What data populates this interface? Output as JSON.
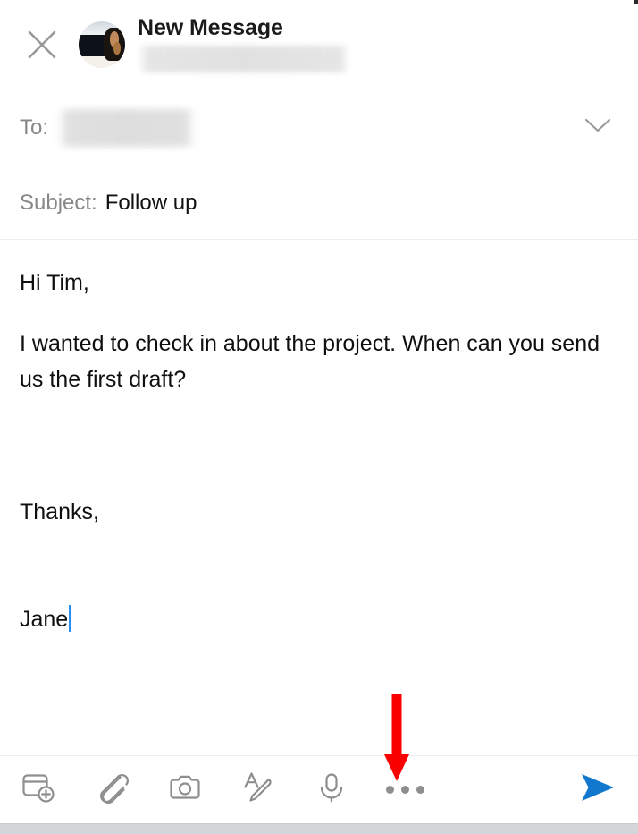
{
  "app": {
    "screen_title": "New Message"
  },
  "header": {
    "close_icon": "close-x-icon",
    "avatar": "user-avatar-photo",
    "title": "New Message",
    "account_redacted": true
  },
  "fields": {
    "to": {
      "label": "To:",
      "value": "",
      "redacted": true,
      "expand_icon": "chevron-down-icon"
    },
    "subject": {
      "label": "Subject:",
      "value": "Follow up"
    }
  },
  "body": {
    "paragraphs": [
      "Hi Tim,",
      "I wanted to check in about the project. When can you send us the first draft?"
    ],
    "signature_lines": [
      "Thanks,",
      "Jane"
    ],
    "caret_visible": true,
    "caret_color": "#2a8ef0"
  },
  "toolbar": {
    "items": [
      {
        "name": "insert-card-icon",
        "label": "Insert"
      },
      {
        "name": "paperclip-icon",
        "label": "Attach file"
      },
      {
        "name": "camera-icon",
        "label": "Camera"
      },
      {
        "name": "format-text-icon",
        "label": "Formatting"
      },
      {
        "name": "microphone-icon",
        "label": "Dictate"
      },
      {
        "name": "more-options-icon",
        "label": "More options"
      }
    ],
    "send": {
      "name": "send-icon",
      "label": "Send",
      "color": "#1278cd"
    },
    "icon_color": "#8e8e8e"
  },
  "annotation": {
    "arrow_color": "#fb0000",
    "points_at": "more-options-icon"
  }
}
